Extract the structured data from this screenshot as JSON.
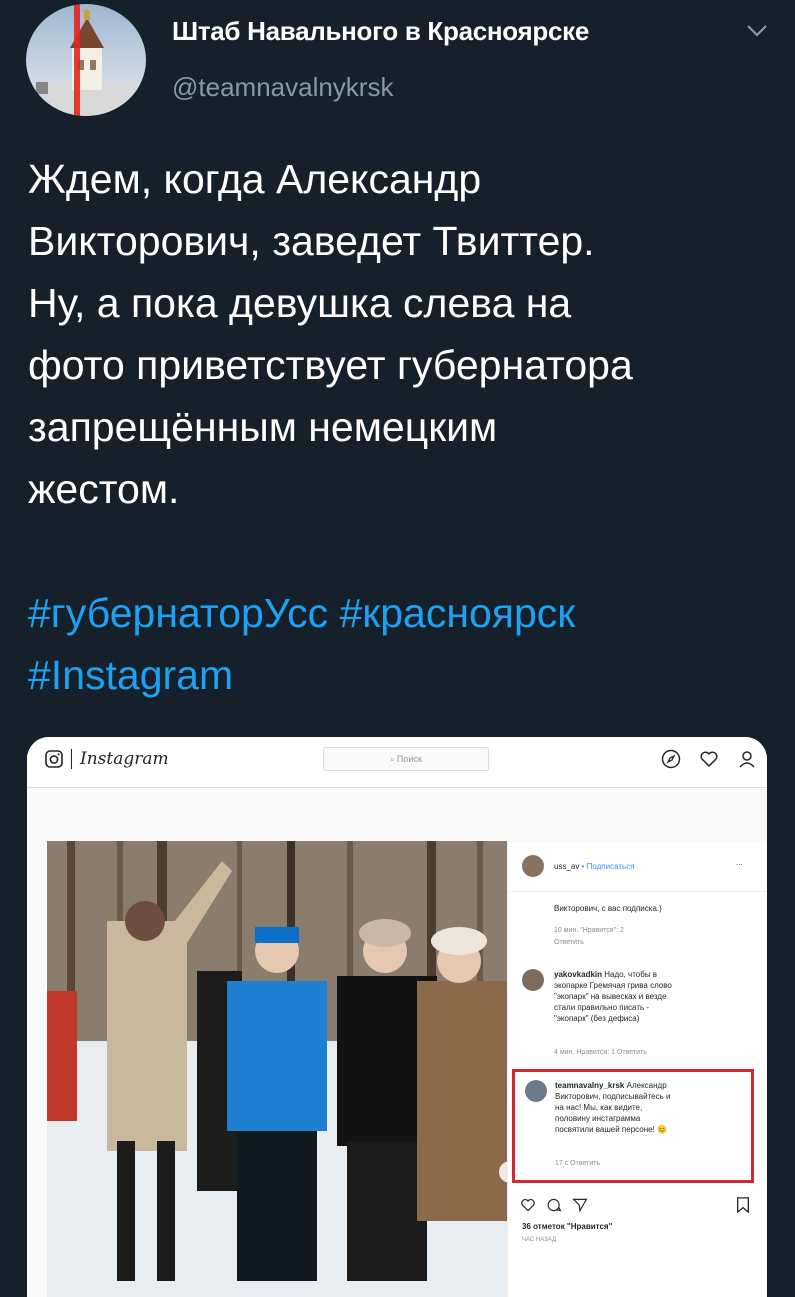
{
  "author": {
    "name": "Штаб Навального в Красноярске",
    "handle": "@teamnavalnykrsk"
  },
  "tweet": {
    "lines": [
      "Ждем, когда Александр",
      "Викторович, заведет Твиттер.",
      "Ну, а пока девушка слева на",
      "фото приветствует губернатора",
      "запрещённым немецким",
      "жестом."
    ],
    "hashtag_lines": [
      "#губернаторУсс #красноярск",
      "#Instagram"
    ]
  },
  "instagram": {
    "logo_text": "Instagram",
    "search_placeholder": "Поиск",
    "post_user": "uss_av",
    "follow_label": "• Подписаться",
    "more_label": "...",
    "comment0_tail": "Викторович, с вас подписка.)",
    "comment0_meta": "10 мин.   \"Нравится\": 2",
    "comment0_reply": "Ответить",
    "comment1_user": "yakovkadkin",
    "comment1_lines": [
      "Надо, чтобы в",
      "экопарке Гремячая грива слово",
      "\"экопарк\" на вывесках и везде",
      "стали правильно писать -",
      "\"экопарк\" (без дефиса)"
    ],
    "comment1_meta": "4 мин.   Нравится: 1   Ответить",
    "comment2_user": "teamnavalny_krsk",
    "comment2_lines": [
      "Александр",
      "Викторович, подписывайтесь и",
      "на нас! Мы, как видите,",
      "половину инстаграмма",
      "посвятили вашей персоне! 😊"
    ],
    "comment2_meta": "17 с   Ответить",
    "likes": "36 отметок \"Нравится\"",
    "time_ago": "ЧАС НАЗАД"
  },
  "icons": [
    "chevron-down-icon",
    "instagram-camera-icon",
    "compass-icon",
    "heart-icon",
    "profile-icon",
    "like-icon",
    "comment-icon",
    "share-icon",
    "bookmark-icon",
    "next-icon"
  ]
}
